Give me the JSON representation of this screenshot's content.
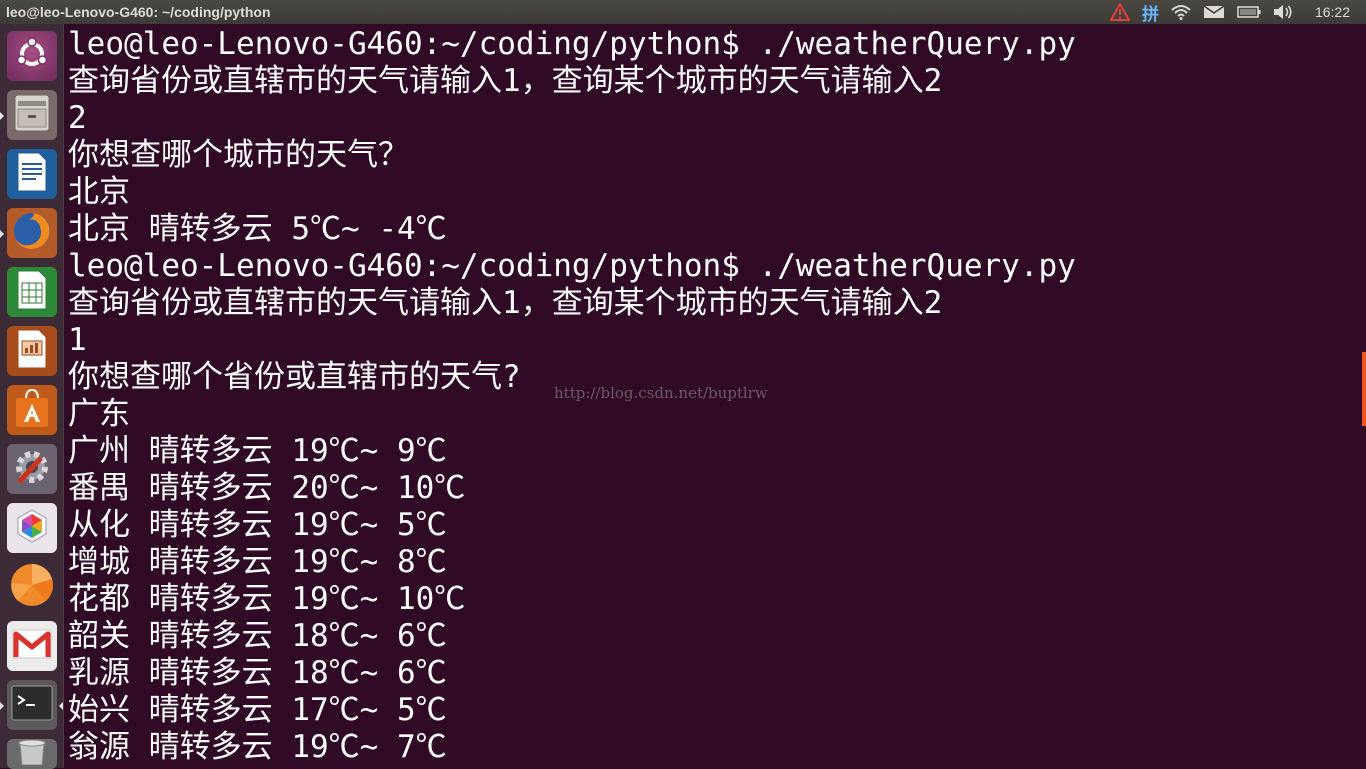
{
  "topbar": {
    "window_title": "leo@leo-Lenovo-G460: ~/coding/python",
    "input_method": "拼",
    "clock": "16:22",
    "icons": [
      "warning-icon",
      "input-method-icon",
      "wifi-icon",
      "mail-icon",
      "battery-icon",
      "volume-icon"
    ]
  },
  "launcher": {
    "items": [
      {
        "name": "dash-home",
        "icon": "ubuntu-logo-icon"
      },
      {
        "name": "files",
        "icon": "file-cabinet-icon"
      },
      {
        "name": "writer",
        "icon": "document-icon"
      },
      {
        "name": "firefox",
        "icon": "firefox-icon"
      },
      {
        "name": "calc",
        "icon": "spreadsheet-icon"
      },
      {
        "name": "impress",
        "icon": "presentation-icon"
      },
      {
        "name": "software-center",
        "icon": "shopping-bag-icon"
      },
      {
        "name": "system-settings",
        "icon": "settings-gear-icon"
      },
      {
        "name": "app",
        "icon": "hexagon-icon"
      },
      {
        "name": "clementine",
        "icon": "orange-icon"
      },
      {
        "name": "gmail",
        "icon": "gmail-icon"
      },
      {
        "name": "terminal",
        "icon": "terminal-icon"
      },
      {
        "name": "trash",
        "icon": "trash-icon"
      }
    ]
  },
  "terminal": {
    "lines": [
      "leo@leo-Lenovo-G460:~/coding/python$ ./weatherQuery.py",
      "查询省份或直辖市的天气请输入1，查询某个城市的天气请输入2",
      "2",
      "你想查哪个城市的天气？",
      "北京",
      "北京 晴转多云 5℃~ -4℃",
      "leo@leo-Lenovo-G460:~/coding/python$ ./weatherQuery.py",
      "查询省份或直辖市的天气请输入1，查询某个城市的天气请输入2",
      "1",
      "你想查哪个省份或直辖市的天气?",
      "广东",
      "广州 晴转多云 19℃~ 9℃",
      "番禺 晴转多云 20℃~ 10℃",
      "从化 晴转多云 19℃~ 5℃",
      "增城 晴转多云 19℃~ 8℃",
      "花都 晴转多云 19℃~ 10℃",
      "韶关 晴转多云 18℃~ 6℃",
      "乳源 晴转多云 18℃~ 6℃",
      "始兴 晴转多云 17℃~ 5℃",
      "翁源 晴转多云 19℃~ 7℃"
    ],
    "watermark": "http://blog.csdn.net/buptlrw"
  },
  "colors": {
    "terminal_bg": "#300a24",
    "panel_bg": "#3c3b37",
    "launcher_bg": "#3c2a36",
    "text": "#ffffff",
    "accent": "#e9541f"
  }
}
